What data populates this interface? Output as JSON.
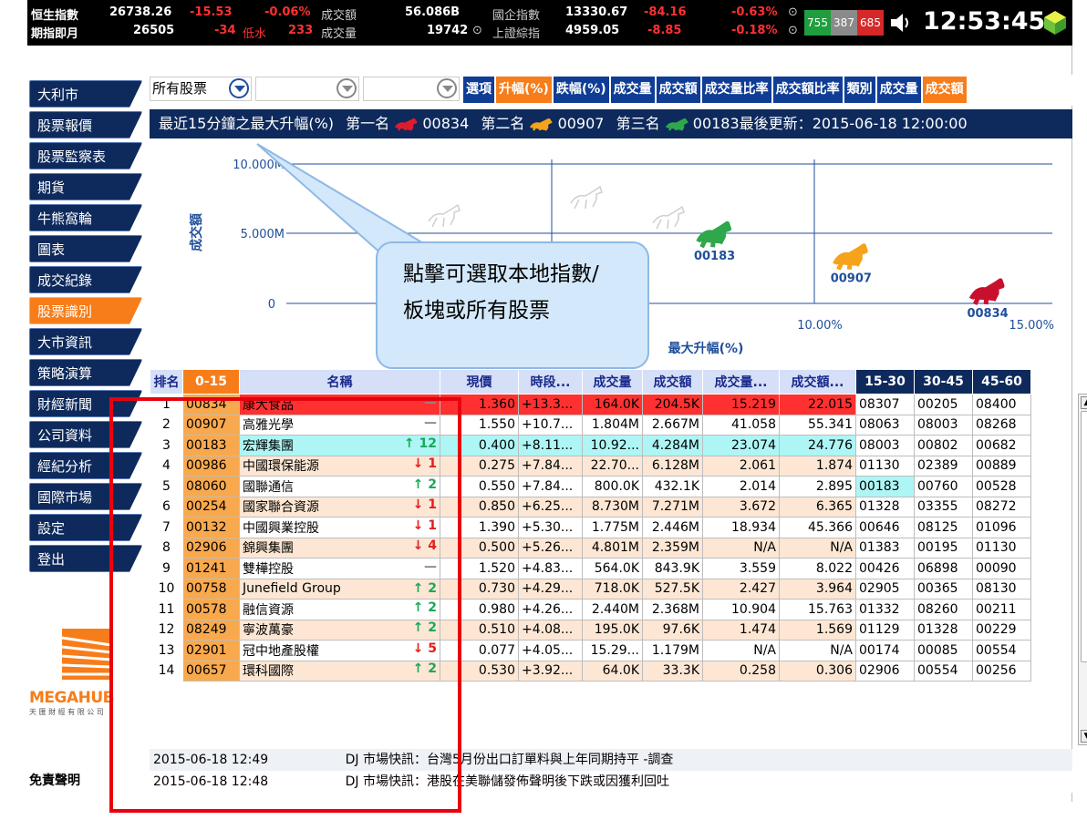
{
  "ticker": {
    "row1": [
      {
        "label": "恒生指數",
        "value": "26738.26",
        "chg": "-15.53",
        "pct": "-0.06%"
      },
      {
        "label": "成交額",
        "value": "56.086B"
      },
      {
        "label": "國企指數",
        "value": "13330.67",
        "chg": "-84.16",
        "pct": "-0.63%"
      }
    ],
    "row2": [
      {
        "label": "期指即月",
        "value": "26505",
        "chg": "-34",
        "basis_label": "低水",
        "basis": "233"
      },
      {
        "label": "成交量",
        "value": "19742"
      },
      {
        "label": "上證綜指",
        "value": "4959.05",
        "chg": "-8.85",
        "pct": "-0.18%"
      }
    ],
    "bars": [
      "755",
      "387",
      "685"
    ],
    "clock": "12:53:45"
  },
  "sidebar": {
    "items": [
      "大利市",
      "股票報價",
      "股票監察表",
      "期貨",
      "牛熊窩輪",
      "圖表",
      "成交紀錄",
      "股票識別",
      "大市資訊",
      "策略演算",
      "財經新聞",
      "公司資料",
      "經紀分析",
      "國際市場",
      "設定",
      "登出"
    ],
    "active": "股票識別",
    "logo_text": "MEGAHUB",
    "logo_sub": "天 匯 財 經 有 限 公 司",
    "disclaimer": "免責聲明"
  },
  "toolbar": {
    "select1": "所有股票",
    "select2": "",
    "select3": "",
    "tabs": [
      "選項",
      "升幅(%)",
      "跌幅(%)",
      "成交量",
      "成交額",
      "成交量比率",
      "成交額比率",
      "類別",
      "成交量",
      "成交額"
    ],
    "active_tabs": [
      1,
      9
    ]
  },
  "banner": {
    "text": "最近15分鐘之最大升幅(%)",
    "first_label": "第一名",
    "first": "00834",
    "second_label": "第二名",
    "second": "00907",
    "third_label": "第三名",
    "third": "00183",
    "updated_label": "最後更新：",
    "updated": "2015-06-18 12:00:00"
  },
  "chart_data": {
    "type": "scatter",
    "ylabel": "成交額",
    "xlabel": "最大升幅(%)",
    "yticks": [
      "10.000M",
      "5.000M",
      "0"
    ],
    "xticks": [
      "10.00%",
      "15.00%"
    ],
    "points": [
      {
        "label": "00834",
        "x": 13.3,
        "y": 0.2,
        "color": "#c8102e"
      },
      {
        "label": "00907",
        "x": 10.7,
        "y": 2.7,
        "color": "#f5a31a"
      },
      {
        "label": "00183",
        "x": 8.1,
        "y": 4.3,
        "color": "#2ea84a"
      }
    ]
  },
  "callout": {
    "line1": "點擊可選取本地指數/",
    "line2": "板塊或所有股票"
  },
  "table": {
    "headers": [
      "排名",
      "0-15",
      "名稱",
      "現價",
      "時段...",
      "成交量",
      "成交額",
      "成交量...",
      "成交額...",
      "15-30",
      "30-45",
      "45-60"
    ],
    "rows": [
      [
        "1",
        "00834",
        "康大食品",
        "—",
        "1.360",
        "+13.3...",
        "164.0K",
        "204.5K",
        "15.219",
        "22.015",
        "08307",
        "00205",
        "08400"
      ],
      [
        "2",
        "00907",
        "高雅光學",
        "—",
        "1.550",
        "+10.7...",
        "1.804M",
        "2.667M",
        "41.058",
        "55.341",
        "08063",
        "08003",
        "08268"
      ],
      [
        "3",
        "00183",
        "宏輝集團",
        "↑ 12",
        "0.400",
        "+8.11...",
        "10.92...",
        "4.284M",
        "23.074",
        "24.776",
        "08003",
        "00802",
        "00682"
      ],
      [
        "4",
        "00986",
        "中國環保能源",
        "↓ 1",
        "0.275",
        "+7.84...",
        "22.70...",
        "6.128M",
        "2.061",
        "1.874",
        "01130",
        "02389",
        "00889"
      ],
      [
        "5",
        "08060",
        "國聯通信",
        "↑ 2",
        "0.550",
        "+7.84...",
        "800.0K",
        "432.1K",
        "2.014",
        "2.895",
        "00183",
        "00760",
        "00528"
      ],
      [
        "6",
        "00254",
        "國家聯合資源",
        "↓ 1",
        "0.850",
        "+6.25...",
        "8.730M",
        "7.271M",
        "3.672",
        "6.365",
        "01328",
        "03355",
        "08272"
      ],
      [
        "7",
        "00132",
        "中國興業控股",
        "↓ 1",
        "1.390",
        "+5.30...",
        "1.775M",
        "2.446M",
        "18.934",
        "45.366",
        "00646",
        "08125",
        "01096"
      ],
      [
        "8",
        "02906",
        "錦興集團",
        "↓ 4",
        "0.500",
        "+5.26...",
        "4.801M",
        "2.359M",
        "N/A",
        "N/A",
        "01383",
        "00195",
        "01130"
      ],
      [
        "9",
        "01241",
        "雙樺控股",
        "—",
        "1.520",
        "+4.83...",
        "564.0K",
        "843.9K",
        "3.559",
        "8.022",
        "00426",
        "06898",
        "00090"
      ],
      [
        "10",
        "00758",
        "Junefield Group",
        "↑ 2",
        "0.730",
        "+4.29...",
        "718.0K",
        "527.5K",
        "2.427",
        "3.964",
        "02905",
        "00365",
        "08130"
      ],
      [
        "11",
        "00578",
        "融信資源",
        "↑ 2",
        "0.980",
        "+4.26...",
        "2.440M",
        "2.368M",
        "10.904",
        "15.763",
        "01332",
        "08260",
        "00211"
      ],
      [
        "12",
        "08249",
        "寧波萬豪",
        "↑ 2",
        "0.510",
        "+4.08...",
        "195.0K",
        "97.6K",
        "1.474",
        "1.569",
        "01129",
        "01328",
        "00229"
      ],
      [
        "13",
        "02901",
        "冠中地產股權",
        "↓ 5",
        "0.077",
        "+4.05...",
        "15.29...",
        "1.179M",
        "N/A",
        "N/A",
        "00174",
        "00085",
        "00554"
      ],
      [
        "14",
        "00657",
        "環科國際",
        "↑ 2",
        "0.530",
        "+3.92...",
        "64.0K",
        "33.3K",
        "0.258",
        "0.306",
        "02906",
        "00554",
        "00256"
      ]
    ]
  },
  "news": [
    {
      "time": "2015-06-18 12:49",
      "text": "DJ 市場快訊：台灣5月份出口訂單料與上年同期持平 -調查"
    },
    {
      "time": "2015-06-18 12:48",
      "text": "DJ 市場快訊：港股在美聯儲發佈聲明後下跌或因獲利回吐"
    }
  ]
}
